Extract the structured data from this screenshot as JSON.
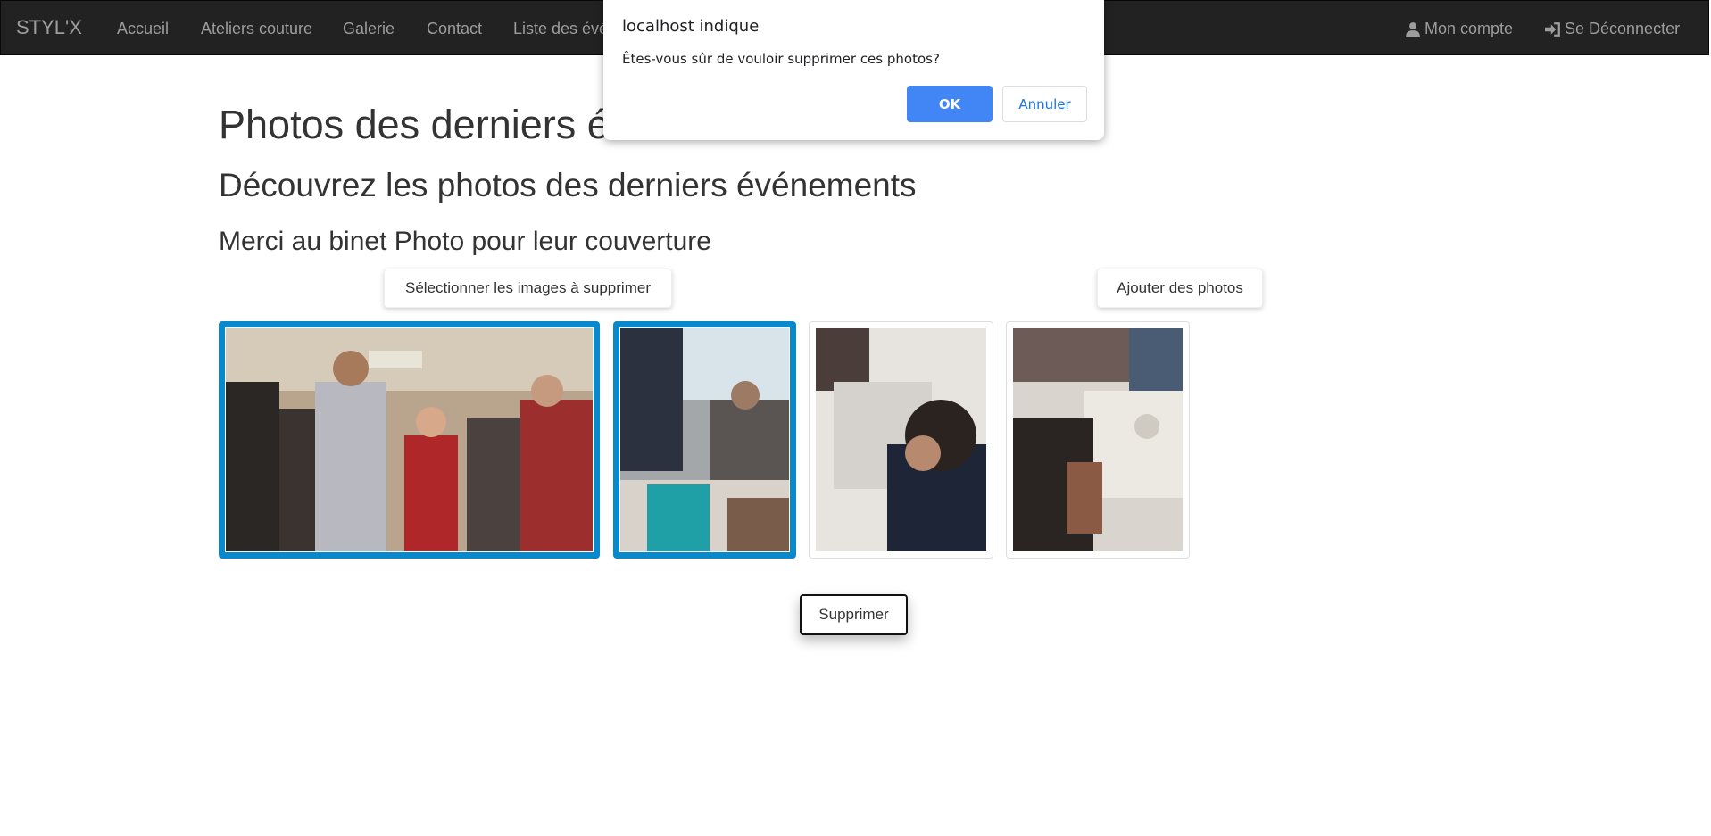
{
  "navbar": {
    "brand": "STYL'X",
    "links": [
      "Accueil",
      "Ateliers couture",
      "Galerie",
      "Contact",
      "Liste des évé"
    ],
    "account": "Mon compte",
    "logout": "Se Déconnecter",
    "icons": [
      "user-icon",
      "log-in-icon"
    ]
  },
  "headings": {
    "h1": "Photos des derniers é",
    "h2": "Découvrez les photos des derniers événements",
    "h3": "Merci au binet Photo pour leur couverture"
  },
  "buttons": {
    "select": "Sélectionner les images à supprimer",
    "add": "Ajouter des photos",
    "delete": "Supprimer"
  },
  "gallery": {
    "selected_color": "#0a88cc",
    "photos": [
      {
        "selected": true
      },
      {
        "selected": true
      },
      {
        "selected": false
      },
      {
        "selected": false
      }
    ]
  },
  "dialog": {
    "title": "localhost indique",
    "message": "Êtes-vous sûr de vouloir supprimer ces photos?",
    "ok": "OK",
    "cancel": "Annuler",
    "ok_color": "#4285f4"
  }
}
